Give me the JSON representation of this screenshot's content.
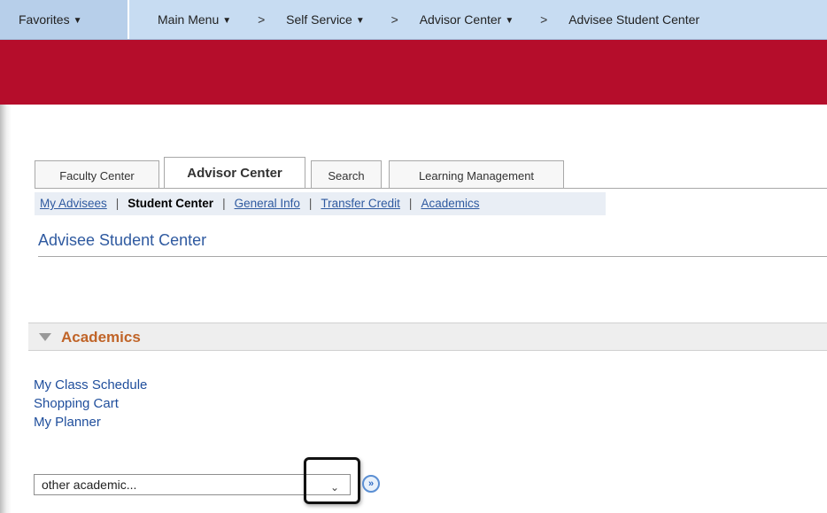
{
  "topnav": {
    "favorites": "Favorites",
    "main_menu": "Main Menu",
    "crumbs": [
      "Self Service",
      "Advisor Center",
      "Advisee Student Center"
    ],
    "separator": ">"
  },
  "tabs": [
    {
      "label": "Faculty Center"
    },
    {
      "label": "Advisor Center",
      "active": true
    },
    {
      "label": "Search"
    },
    {
      "label": "Learning Management"
    }
  ],
  "subnav": {
    "items": [
      "My Advisees",
      "Student Center",
      "General Info",
      "Transfer Credit",
      "Academics"
    ],
    "separator": "|"
  },
  "page": {
    "title": "Advisee Student Center"
  },
  "academics": {
    "header": "Academics",
    "links": [
      "My Class Schedule",
      "Shopping Cart",
      "My Planner"
    ],
    "select_value": "other academic..."
  },
  "colors": {
    "accent_red": "#b50d2b",
    "link_blue": "#2f5aa0",
    "section_orange": "#c06428"
  }
}
